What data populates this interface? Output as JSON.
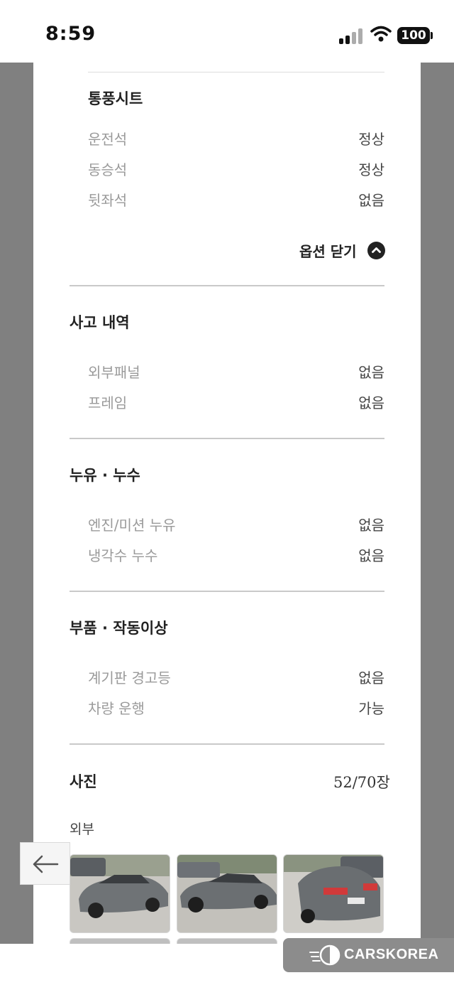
{
  "status_bar": {
    "time": "8:59",
    "battery": "100"
  },
  "ventilated_seats": {
    "title": "통풍시트",
    "rows": [
      {
        "label": "운전석",
        "value": "정상"
      },
      {
        "label": "동승석",
        "value": "정상"
      },
      {
        "label": "뒷좌석",
        "value": "없음"
      }
    ],
    "close_options": "옵션 닫기"
  },
  "accident_history": {
    "title": "사고 내역",
    "rows": [
      {
        "label": "외부패널",
        "value": "없음"
      },
      {
        "label": "프레임",
        "value": "없음"
      }
    ]
  },
  "leaks": {
    "title": "누유 · 누수",
    "rows": [
      {
        "label": "엔진/미션 누유",
        "value": "없음"
      },
      {
        "label": "냉각수 누수",
        "value": "없음"
      }
    ]
  },
  "parts_malfunction": {
    "title": "부품 · 작동이상",
    "rows": [
      {
        "label": "계기판 경고등",
        "value": "없음"
      },
      {
        "label": "차량 운행",
        "value": "가능"
      }
    ]
  },
  "photos": {
    "title": "사진",
    "count": "52/70장",
    "category": "외부"
  },
  "brand": {
    "name": "CARSKOREA"
  },
  "colors": {
    "side_gray": "#808080",
    "car_gray": "#6f7376",
    "taillight": "#d13a3a"
  }
}
